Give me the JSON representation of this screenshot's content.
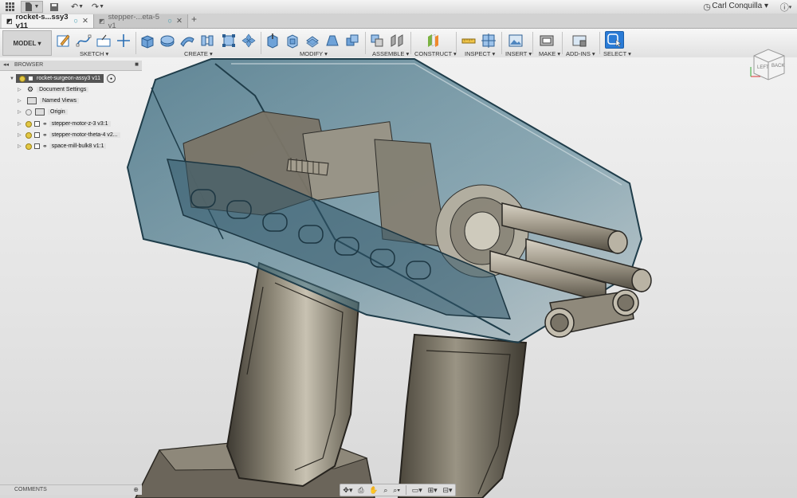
{
  "user": {
    "name": "Carl Conquilla"
  },
  "tabs": [
    {
      "label": "rocket-s...ssy3 v11",
      "active": true
    },
    {
      "label": "stepper-...eta-5 v1",
      "active": false
    }
  ],
  "tab_status_glyph": "○",
  "tab_close_glyph": "✕",
  "new_tab_glyph": "+",
  "workspace": {
    "label": "MODEL ▾"
  },
  "toolbar_groups": [
    {
      "label": "SKETCH ▾"
    },
    {
      "label": "CREATE ▾"
    },
    {
      "label": "MODIFY ▾"
    },
    {
      "label": "ASSEMBLE ▾"
    },
    {
      "label": "CONSTRUCT ▾"
    },
    {
      "label": "INSPECT ▾"
    },
    {
      "label": "INSERT ▾"
    },
    {
      "label": "MAKE ▾"
    },
    {
      "label": "ADD-INS ▾"
    },
    {
      "label": "SELECT ▾"
    }
  ],
  "browser": {
    "title": "BROWSER",
    "root": "rocket-surgeon-assy3 v11",
    "items": [
      {
        "label": "Document Settings"
      },
      {
        "label": "Named Views"
      },
      {
        "label": "Origin"
      },
      {
        "label": "stepper-motor-z-3 v3:1"
      },
      {
        "label": "stepper-motor-theta-4 v2..."
      },
      {
        "label": "space-mill-bulk8 v1:1"
      }
    ]
  },
  "comments": {
    "title": "COMMENTS"
  },
  "viewcube": {
    "face_front": "LEFT",
    "face_side": "BACK"
  },
  "icons": {
    "grid": "app-grid-icon",
    "file": "file-icon",
    "save": "save-icon",
    "undo": "undo-icon",
    "redo": "redo-icon",
    "clock": "job-status-icon",
    "help": "help-icon"
  },
  "colors": {
    "shell": "#2f5f73",
    "metal": "#7d7769",
    "select_blue": "#2a7bd6"
  }
}
